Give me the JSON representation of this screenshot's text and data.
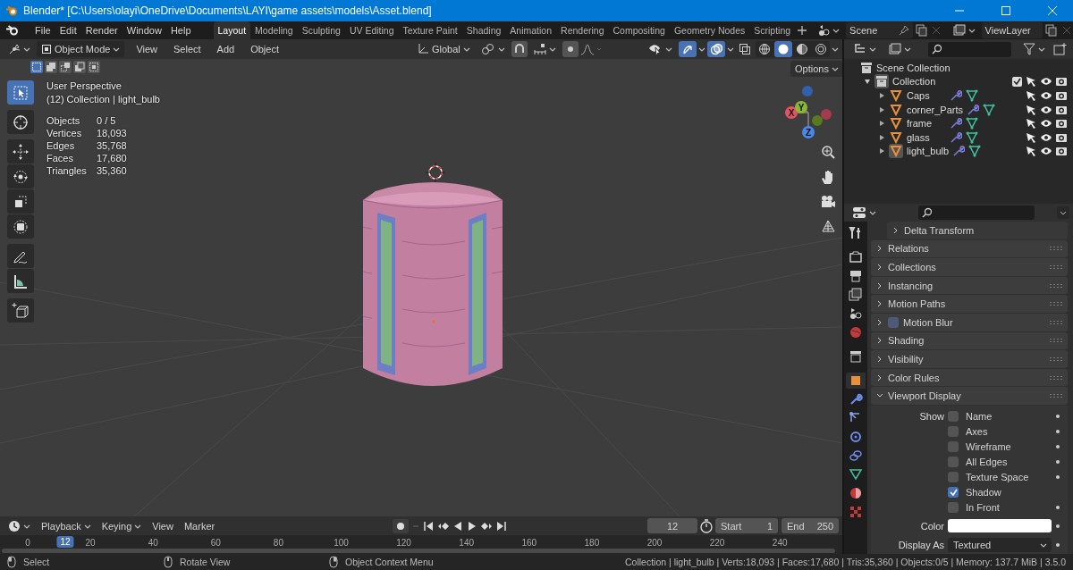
{
  "window": {
    "title": "Blender* [C:\\Users\\olayi\\OneDrive\\Documents\\LAYI\\game assets\\models\\Asset.blend]"
  },
  "menu": [
    "File",
    "Edit",
    "Render",
    "Window",
    "Help"
  ],
  "workspaces": [
    {
      "label": "Layout",
      "selected": true
    },
    {
      "label": "Modeling",
      "selected": false
    },
    {
      "label": "Sculpting",
      "selected": false
    },
    {
      "label": "UV Editing",
      "selected": false
    },
    {
      "label": "Texture Paint",
      "selected": false
    },
    {
      "label": "Shading",
      "selected": false
    },
    {
      "label": "Animation",
      "selected": false
    },
    {
      "label": "Rendering",
      "selected": false
    },
    {
      "label": "Compositing",
      "selected": false
    },
    {
      "label": "Geometry Nodes",
      "selected": false
    },
    {
      "label": "Scripting",
      "selected": false
    }
  ],
  "scene": {
    "name": "Scene"
  },
  "view_layer": {
    "name": "ViewLayer"
  },
  "viewport": {
    "mode": "Object Mode",
    "menus": [
      "View",
      "Select",
      "Add",
      "Object"
    ],
    "orientation": "Global",
    "options": "Options",
    "toggles": [
      {
        "kind": "gizmos",
        "on": true
      },
      {
        "kind": "overlays",
        "on": true
      },
      {
        "kind": "xray",
        "on": false
      }
    ],
    "shading_modes": [
      {
        "kind": "wireframe",
        "selected": false
      },
      {
        "kind": "solid",
        "selected": true
      },
      {
        "kind": "material",
        "selected": false
      },
      {
        "kind": "rendered",
        "selected": false
      }
    ],
    "select_modes": [
      {
        "kind": "set",
        "selected": true
      },
      {
        "kind": "extend",
        "selected": false
      },
      {
        "kind": "subtract",
        "selected": false
      },
      {
        "kind": "invert",
        "selected": false
      },
      {
        "kind": "intersect",
        "selected": false
      }
    ],
    "tools": [
      {
        "kind": "select",
        "selected": true
      },
      {
        "kind": "cursor",
        "selected": false
      },
      {
        "kind": "move",
        "selected": false
      },
      {
        "kind": "rotate",
        "selected": false
      },
      {
        "kind": "scale",
        "selected": false
      },
      {
        "kind": "transform",
        "selected": false
      },
      {
        "kind": "annotate",
        "selected": false
      },
      {
        "kind": "measure",
        "selected": false
      },
      {
        "kind": "add-cube",
        "selected": false
      }
    ],
    "view_name": "User Perspective",
    "context": "(12) Collection | light_bulb",
    "stats": [
      {
        "label": "Objects",
        "value": "0 / 5"
      },
      {
        "label": "Vertices",
        "value": "18,093"
      },
      {
        "label": "Edges",
        "value": "35,768"
      },
      {
        "label": "Faces",
        "value": "17,680"
      },
      {
        "label": "Triangles",
        "value": "35,360"
      }
    ],
    "gizmo_axes": [
      "X",
      "Y",
      "Z"
    ]
  },
  "outliner": {
    "root": "Scene Collection",
    "collection": {
      "label": "Collection",
      "expanded": true,
      "checked": true,
      "children": [
        {
          "label": "Caps",
          "selected": false
        },
        {
          "label": "corner_Parts",
          "selected": false
        },
        {
          "label": "frame",
          "selected": false
        },
        {
          "label": "glass",
          "selected": false
        },
        {
          "label": "light_bulb",
          "selected": true
        }
      ]
    }
  },
  "properties": {
    "tabs": [
      {
        "kind": "tool",
        "selected": false
      },
      {
        "kind": "render",
        "selected": false
      },
      {
        "kind": "output",
        "selected": false
      },
      {
        "kind": "view-layer",
        "selected": false
      },
      {
        "kind": "scene",
        "selected": false
      },
      {
        "kind": "world",
        "selected": false
      },
      {
        "kind": "collection",
        "selected": false
      },
      {
        "kind": "object",
        "selected": true
      },
      {
        "kind": "modifiers",
        "selected": false
      },
      {
        "kind": "particles",
        "selected": false
      },
      {
        "kind": "physics",
        "selected": false
      },
      {
        "kind": "constraints",
        "selected": false
      },
      {
        "kind": "data",
        "selected": false
      },
      {
        "kind": "material",
        "selected": false
      },
      {
        "kind": "texture",
        "selected": false
      }
    ],
    "panels": [
      {
        "label": "Delta Transform",
        "kind": "subpanel",
        "expanded": false
      },
      {
        "label": "Relations",
        "kind": "panel",
        "expanded": false
      },
      {
        "label": "Collections",
        "kind": "panel",
        "expanded": false
      },
      {
        "label": "Instancing",
        "kind": "panel",
        "expanded": false
      },
      {
        "label": "Motion Paths",
        "kind": "panel",
        "expanded": false
      },
      {
        "label": "Motion Blur",
        "kind": "panel",
        "expanded": false,
        "checked": false
      },
      {
        "label": "Shading",
        "kind": "panel",
        "expanded": false
      },
      {
        "label": "Visibility",
        "kind": "panel",
        "expanded": false
      },
      {
        "label": "Color Rules",
        "kind": "panel",
        "expanded": false
      },
      {
        "label": "Viewport Display",
        "kind": "panel",
        "expanded": true
      }
    ],
    "viewport_display": {
      "show_label": "Show",
      "options": [
        {
          "label": "Name",
          "checked": false
        },
        {
          "label": "Axes",
          "checked": false
        },
        {
          "label": "Wireframe",
          "checked": false
        },
        {
          "label": "All Edges",
          "checked": false
        },
        {
          "label": "Texture Space",
          "checked": false
        },
        {
          "label": "Shadow",
          "checked": true
        },
        {
          "label": "In Front",
          "checked": false
        }
      ],
      "color_label": "Color",
      "display_as_label": "Display As",
      "display_as": "Textured"
    }
  },
  "timeline": {
    "menus": [
      "Playback",
      "Keying",
      "View",
      "Marker"
    ],
    "current_frame": "12",
    "start_label": "Start",
    "start": "1",
    "end_label": "End",
    "end": "250",
    "playhead": "12",
    "ticks": [
      "0",
      "20",
      "40",
      "60",
      "80",
      "100",
      "120",
      "140",
      "160",
      "180",
      "200",
      "220",
      "240"
    ]
  },
  "status_bar": {
    "hints": [
      "Select",
      "Rotate View",
      "Object Context Menu"
    ],
    "info": "Collection | light_bulb | Verts:18,093 | Faces:17,680 | Tris:35,360 | Objects:0/5 | Memory: 137.7 MiB | 3.5.0"
  }
}
